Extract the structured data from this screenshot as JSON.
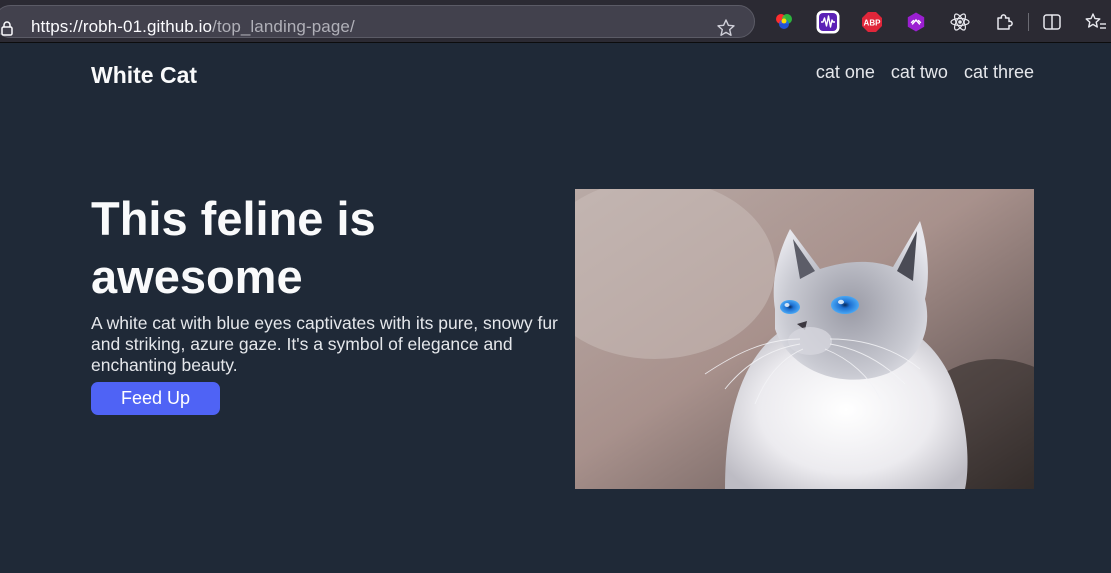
{
  "browser": {
    "url_host": "https://robh-01.github.io",
    "url_path": "/top_landing-page/",
    "extensions": [
      "color-picker-icon",
      "sound-wave-icon",
      "adblock-plus-icon",
      "infinity-icon",
      "react-devtools-icon",
      "puzzle-icon",
      "reader-view-icon",
      "bookmarks-icon"
    ],
    "abp_label": "ABP"
  },
  "header": {
    "title": "White Cat",
    "nav": [
      "cat one",
      "cat two",
      "cat three"
    ]
  },
  "hero": {
    "title": "This feline is awesome",
    "text": "A white cat with blue eyes captivates with its pure, snowy fur and striking, azure gaze. It's a symbol of elegance and enchanting beauty.",
    "button": "Feed Up",
    "image_subject": "white cat with blue eyes"
  },
  "colors": {
    "page_bg": "#1f2937",
    "button": "#4f63f5",
    "text": "#f9fafb"
  }
}
